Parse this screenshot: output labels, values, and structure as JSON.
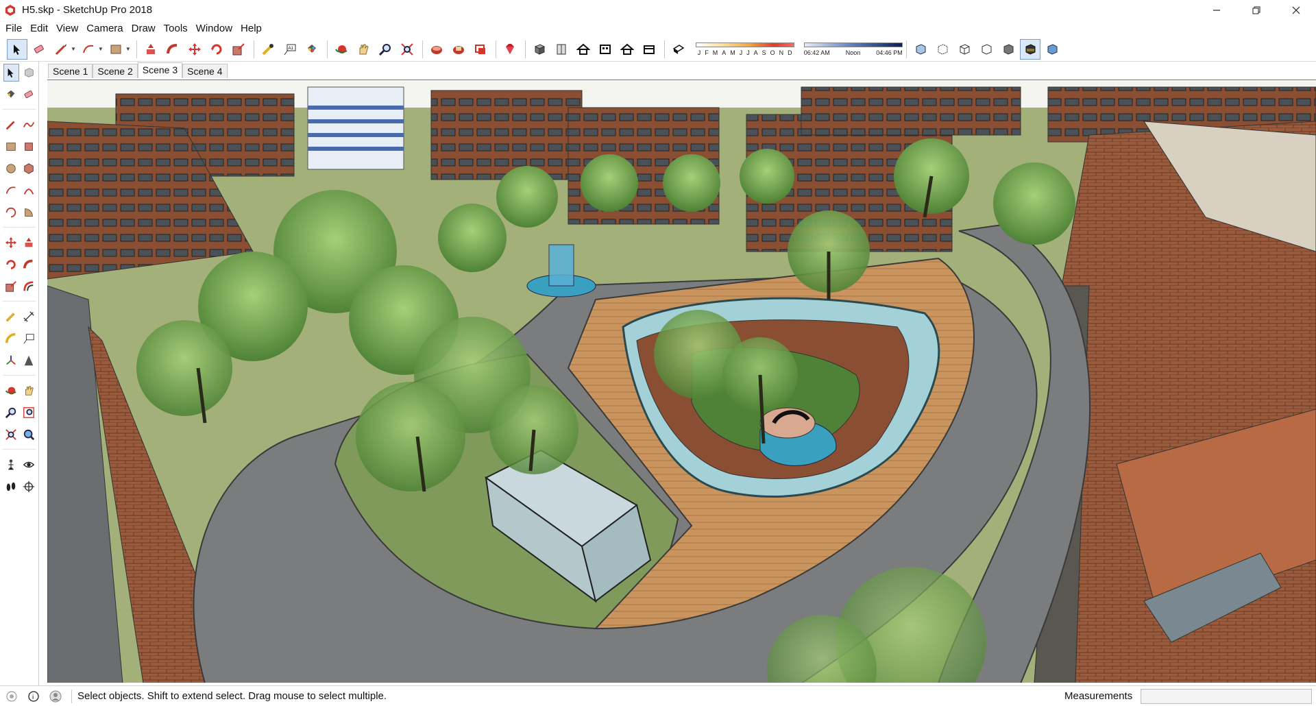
{
  "window": {
    "title": "H5.skp - SketchUp Pro 2018",
    "app_icon": "sketchup-icon",
    "controls": [
      "minimize-icon",
      "restore-icon",
      "close-icon"
    ]
  },
  "menu": [
    "File",
    "Edit",
    "View",
    "Camera",
    "Draw",
    "Tools",
    "Window",
    "Help"
  ],
  "toolbar": {
    "tools": [
      "select-icon",
      "eraser-icon",
      "pencil-line-icon",
      "arc-icon",
      "rectangle-icon",
      "push-pull-icon",
      "follow-me-icon",
      "move-icon",
      "rotate-icon",
      "scale-icon",
      "tape-measure-icon",
      "text-icon",
      "paint-bucket-icon",
      "orbit-icon",
      "pan-icon",
      "zoom-icon",
      "zoom-extents-icon",
      "warehouse-icon",
      "extension-warehouse-icon",
      "layout-icon",
      "ruby-icon",
      "iso-view-icon",
      "front-view-icon",
      "top-view-icon",
      "side-view-icon",
      "back-view-icon",
      "left-view-icon",
      "shadows-toggle-icon"
    ],
    "shadow_months": [
      "J",
      "F",
      "M",
      "A",
      "M",
      "J",
      "J",
      "A",
      "S",
      "O",
      "N",
      "D"
    ],
    "time_start": "06:42 AM",
    "time_mid": "Noon",
    "time_end": "04:46 PM",
    "style_tools": [
      "xray-icon",
      "back-edges-icon",
      "wireframe-icon",
      "hidden-line-icon",
      "shaded-icon",
      "shaded-textures-icon",
      "monochrome-icon"
    ],
    "colors": {
      "active_bg": "#dbe8f7",
      "active_border": "#7a9cc6"
    }
  },
  "left_tools": [
    "select-icon",
    "make-component-icon",
    "paint-bucket-icon",
    "eraser-icon",
    "line-icon",
    "freehand-icon",
    "rectangle-icon",
    "rotated-rectangle-icon",
    "circle-icon",
    "polygon-icon",
    "arc-icon",
    "two-point-arc-icon",
    "three-point-arc-icon",
    "pie-icon",
    "move-icon",
    "push-pull-icon",
    "rotate-icon",
    "follow-me-icon",
    "scale-icon",
    "offset-icon",
    "tape-measure-icon",
    "dimension-icon",
    "protractor-icon",
    "text-icon",
    "axes-icon",
    "3d-text-icon",
    "orbit-icon",
    "pan-icon",
    "zoom-icon",
    "zoom-window-icon",
    "zoom-extents-icon",
    "previous-view-icon",
    "position-camera-icon",
    "look-around-icon",
    "walk-icon",
    "section-plane-icon"
  ],
  "scenes": [
    "Scene 1",
    "Scene 2",
    "Scene 3",
    "Scene 4"
  ],
  "active_scene": "Scene 3",
  "status": {
    "message": "Select objects. Shift to extend select. Drag mouse to select multiple.",
    "measurements_label": "Measurements",
    "measurements_value": "",
    "icons": [
      "geo-location-icon",
      "credits-icon",
      "user-icon"
    ]
  }
}
